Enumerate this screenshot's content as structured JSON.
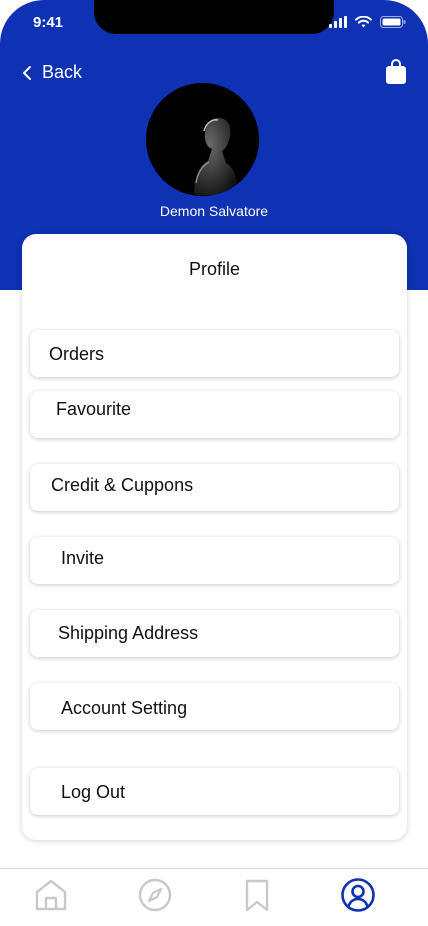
{
  "status_bar": {
    "time": "9:41"
  },
  "header": {
    "back_label": "Back"
  },
  "profile": {
    "name": "Demon Salvatore"
  },
  "card": {
    "title": "Profile"
  },
  "menu": {
    "items": [
      {
        "label": "Orders"
      },
      {
        "label": "Favourite"
      },
      {
        "label": "Credit & Cuppons"
      },
      {
        "label": "Invite"
      },
      {
        "label": "Shipping Address"
      },
      {
        "label": "Account Setting"
      },
      {
        "label": "Log Out"
      }
    ]
  },
  "tabs": {
    "items": [
      {
        "icon": "home-icon",
        "active": false
      },
      {
        "icon": "compass-icon",
        "active": false
      },
      {
        "icon": "bookmark-icon",
        "active": false
      },
      {
        "icon": "user-profile-icon",
        "active": true
      }
    ]
  },
  "colors": {
    "brand": "#0f31b3",
    "inactive_icon": "#c9c9c9"
  }
}
